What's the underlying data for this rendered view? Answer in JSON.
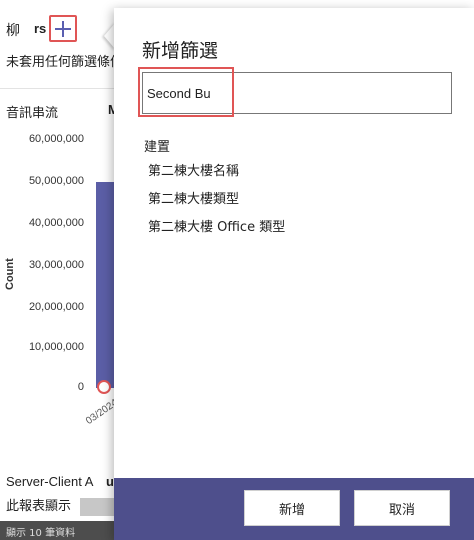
{
  "background": {
    "title_char": "柳",
    "title_bold": "rs",
    "no_filter_text": "未套用任何篩選條件",
    "section_label": "音訊串流",
    "section_bold": "M",
    "y_axis_label": "Count",
    "y_ticks": [
      "60,000,000",
      "50,000,000",
      "40,000,000",
      "30,000,000",
      "20,000,000",
      "10,000,000",
      "0"
    ],
    "x_tick": "03/2024",
    "server_client_label": "Server-Client A",
    "server_client_bold": "u",
    "report_text": "此報表顯示",
    "footer_text": "顯示 10 筆資料",
    "colors": {
      "bar": "#5b5ea6",
      "highlight": "#e05555"
    }
  },
  "flyout": {
    "title": "新增篩選",
    "search_value": "Second Bu",
    "group_header": "建置",
    "options": [
      "第二棟大樓名稱",
      "第二棟大樓類型",
      "第二棟大樓 Office 類型"
    ],
    "add_label": "新增",
    "cancel_label": "取消",
    "colors": {
      "footer": "#4e4f8c"
    }
  }
}
